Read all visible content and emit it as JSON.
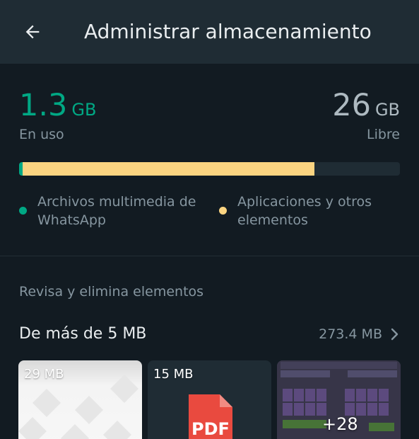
{
  "appbar": {
    "title": "Administrar almacenamiento"
  },
  "storage": {
    "used_value": "1.3",
    "used_unit": "GB",
    "used_label": "En uso",
    "free_value": "26",
    "free_unit": "GB",
    "free_label": "Libre",
    "bar": {
      "media_fraction": 0.009,
      "apps_fraction": 0.766
    },
    "legend": [
      {
        "label": "Archivos multimedia de WhatsApp",
        "color": "#00a884"
      },
      {
        "label": "Aplicaciones y otros elementos",
        "color": "#fbd481"
      }
    ]
  },
  "review": {
    "section_header": "Revisa y elimina elementos",
    "large_files": {
      "title": "De más de 5 MB",
      "total_size": "273.4 MB"
    },
    "thumbnails": [
      {
        "size": "29 MB"
      },
      {
        "size": "15 MB",
        "icon_label": "PDF"
      },
      {
        "count": "+28"
      }
    ]
  },
  "colors": {
    "accent": "#00a884",
    "apps": "#fbd481",
    "appbar": "#1f2c34",
    "background": "#121b22",
    "pdf_red": "#e94a3f"
  },
  "icons": [
    "back-arrow-icon",
    "chevron-right-icon",
    "pdf-file-icon"
  ]
}
